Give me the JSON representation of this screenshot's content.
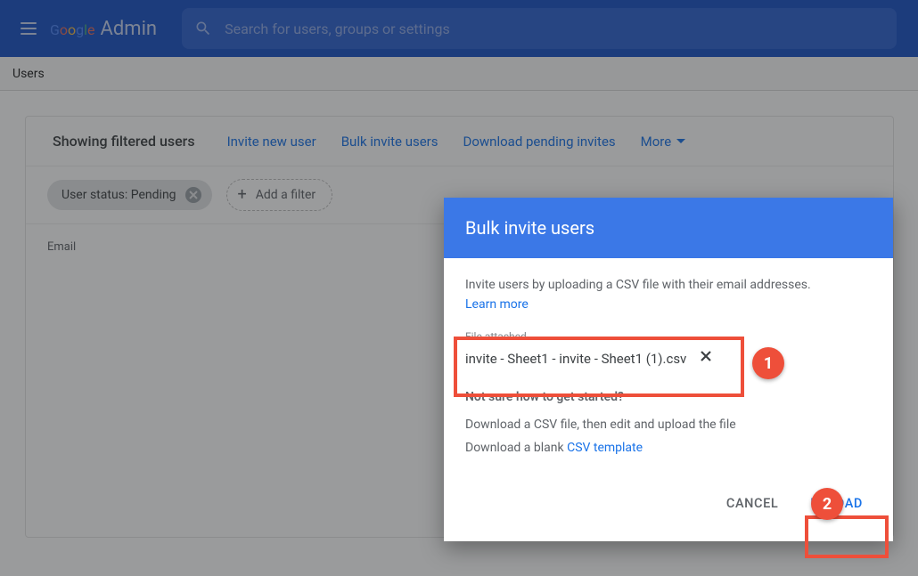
{
  "header": {
    "logo_product": "Google",
    "logo_suffix": "Admin",
    "search_placeholder": "Search for users, groups or settings"
  },
  "breadcrumb": {
    "title": "Users"
  },
  "toolbar": {
    "showing_label": "Showing filtered users",
    "invite_new_user": "Invite new user",
    "bulk_invite_users": "Bulk invite users",
    "download_pending": "Download pending invites",
    "more_label": "More"
  },
  "filters": {
    "chip_user_status": "User status: Pending",
    "add_filter_label": "Add a filter"
  },
  "table": {
    "col_email": "Email"
  },
  "dialog": {
    "title": "Bulk invite users",
    "intro": "Invite users by uploading a CSV file with their email addresses.",
    "learn_more": "Learn more",
    "file_attached_label": "File attached",
    "file_name": "invite - Sheet1 - invite - Sheet1 (1).csv",
    "subtitle": "Not sure how to get started?",
    "download_hint_prefix": "Download a CSV file, then edit and upload the file",
    "download_blank_prefix": "Download a blank ",
    "csv_template_link": "CSV template",
    "cancel": "CANCEL",
    "upload": "UPLOAD"
  },
  "annotations": {
    "n1": "1",
    "n2": "2"
  }
}
